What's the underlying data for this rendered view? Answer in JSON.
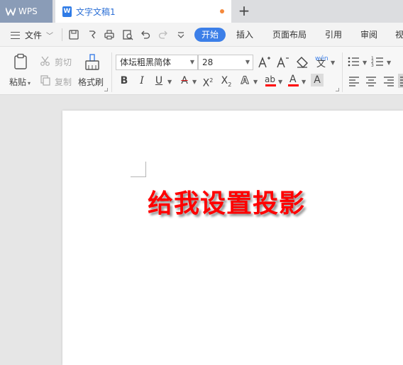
{
  "titlebar": {
    "app_tab": "WPS",
    "doc_tab": "文字文稿1",
    "unsaved_color": "#f4883b"
  },
  "menubar": {
    "file_label": "文件",
    "tabs": [
      "开始",
      "插入",
      "页面布局",
      "引用",
      "审阅",
      "视"
    ],
    "active_tab": "开始",
    "active_color": "#3c7fe8"
  },
  "ribbon": {
    "paste_label": "粘贴",
    "cut_label": "剪切",
    "copy_label": "复制",
    "format_painter_label": "格式刷",
    "font_name": "体坛粗黑简体",
    "font_size": "28",
    "pinyin_label": "wén"
  },
  "document": {
    "text": "给我设置投影",
    "text_color": "#ff0000"
  }
}
